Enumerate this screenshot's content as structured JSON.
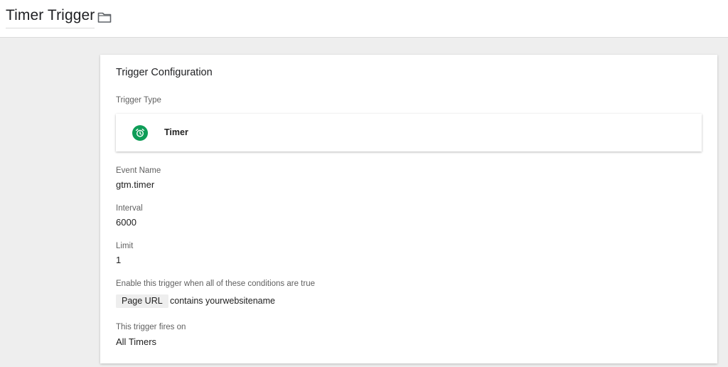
{
  "header": {
    "title": "Timer Trigger",
    "folder_icon": "folder-icon"
  },
  "card": {
    "title": "Trigger Configuration",
    "trigger_type": {
      "label": "Trigger Type",
      "name": "Timer",
      "icon": "alarm-clock-icon",
      "icon_color": "#0f9d58"
    },
    "event_name": {
      "label": "Event Name",
      "value": "gtm.timer"
    },
    "interval": {
      "label": "Interval",
      "value": "6000"
    },
    "limit": {
      "label": "Limit",
      "value": "1"
    },
    "condition": {
      "label": "Enable this trigger when all of these conditions are true",
      "variable": "Page URL",
      "operator_value": "contains yourwebsitename"
    },
    "fires_on": {
      "label": "This trigger fires on",
      "value": "All Timers"
    }
  }
}
